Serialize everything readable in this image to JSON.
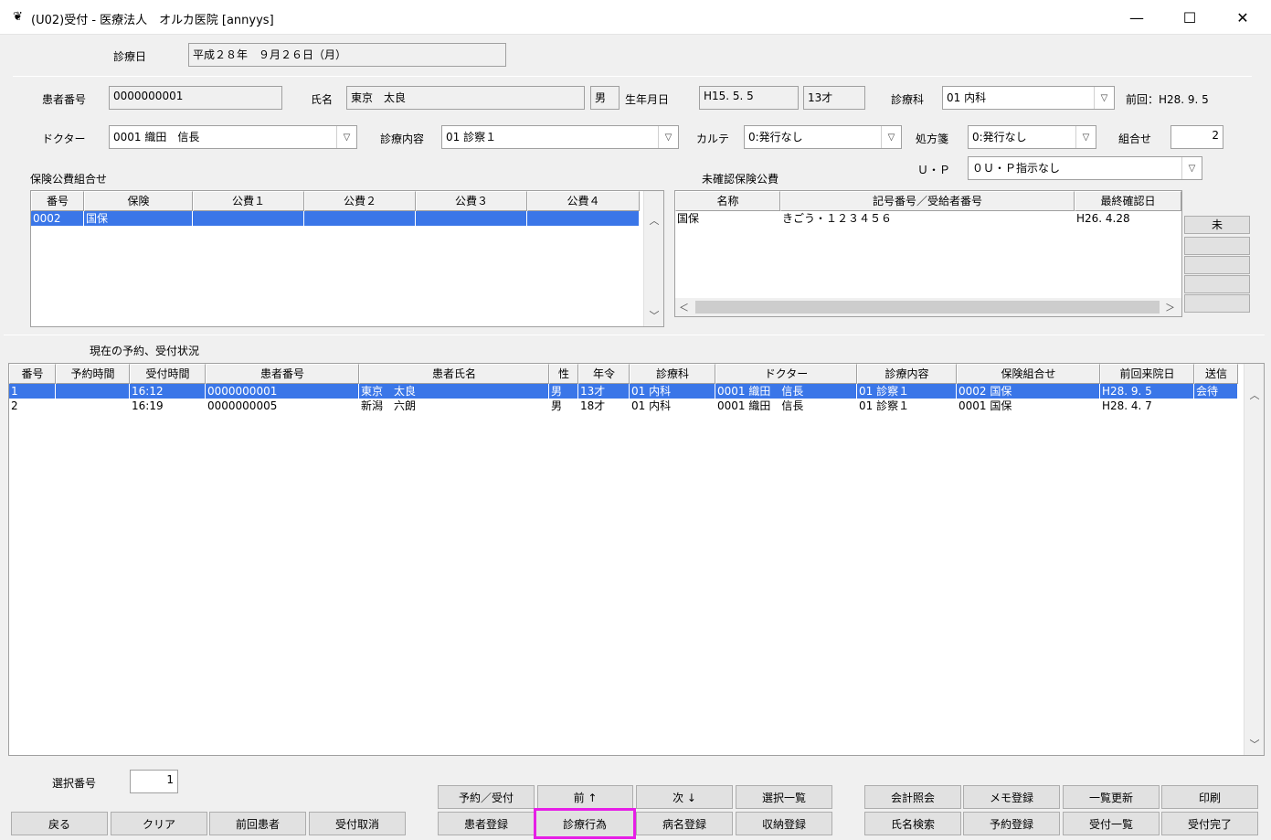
{
  "window": {
    "title": "(U02)受付 - 医療法人　オルカ医院 [annyys]",
    "minimize": "—",
    "maximize": "☐",
    "close": "✕"
  },
  "header": {
    "shinryobi_label": "診療日",
    "shinryobi_value": "平成２８年　９月２６日（月）"
  },
  "patient": {
    "id_label": "患者番号",
    "id_value": "0000000001",
    "name_label": "氏名",
    "name_value": "東京　太良",
    "sex_value": "男",
    "birth_label": "生年月日",
    "birth_value": "H15. 5. 5",
    "age_value": "13才",
    "dept_label": "診療科",
    "dept_value": "01 内科",
    "prev_label": "前回：H28. 9. 5",
    "doctor_label": "ドクター",
    "doctor_value": "0001 織田　信長",
    "content_label": "診療内容",
    "content_value": "01 診察１",
    "karte_label": "カルテ",
    "karte_value": "0:発行なし",
    "rx_label": "処方箋",
    "rx_value": "0:発行なし",
    "combo_label": "組合せ",
    "combo_value": "2",
    "up_label": "Ｕ・Ｐ",
    "up_value": "０Ｕ・Ｐ指示なし"
  },
  "insurance": {
    "title": "保険公費組合せ",
    "headers": [
      "番号",
      "保険",
      "公費１",
      "公費２",
      "公費３",
      "公費４"
    ],
    "rows": [
      [
        "0002",
        "国保",
        "",
        "",
        "",
        ""
      ]
    ]
  },
  "unconfirmed": {
    "title": "未確認保険公費",
    "headers": [
      "名称",
      "記号番号／受給者番号",
      "最終確認日"
    ],
    "rows": [
      [
        "国保",
        "きごう・１２３４５６",
        "H26. 4.28"
      ]
    ],
    "side_buttons": [
      "未",
      "",
      "",
      "",
      ""
    ]
  },
  "reception": {
    "title": "現在の予約、受付状況",
    "headers": [
      "番号",
      "予約時間",
      "受付時間",
      "患者番号",
      "患者氏名",
      "性",
      "年令",
      "診療科",
      "ドクター",
      "診療内容",
      "保険組合せ",
      "前回来院日",
      "送信"
    ],
    "rows": [
      [
        "1",
        "",
        "16:12",
        "0000000001",
        "東京　太良",
        "男",
        "13才",
        "01 内科",
        "0001 織田　信長",
        "01 診察１",
        "0002 国保",
        "H28. 9. 5",
        "会待"
      ],
      [
        "2",
        "",
        "16:19",
        "0000000005",
        "新潟　六朗",
        "男",
        "18才",
        "01 内科",
        "0001 織田　信長",
        "01 診察１",
        "0001 国保",
        "H28. 4. 7",
        ""
      ]
    ]
  },
  "footer": {
    "select_label": "選択番号",
    "select_value": "1",
    "buttons_top": [
      "予約／受付",
      "前 ↑",
      "次 ↓",
      "選択一覧",
      "会計照会",
      "メモ登録",
      "一覧更新",
      "印刷"
    ],
    "buttons_bottom": [
      "戻る",
      "クリア",
      "前回患者",
      "受付取消",
      "患者登録",
      "診療行為",
      "病名登録",
      "収納登録",
      "氏名検索",
      "予約登録",
      "受付一覧",
      "受付完了"
    ]
  }
}
